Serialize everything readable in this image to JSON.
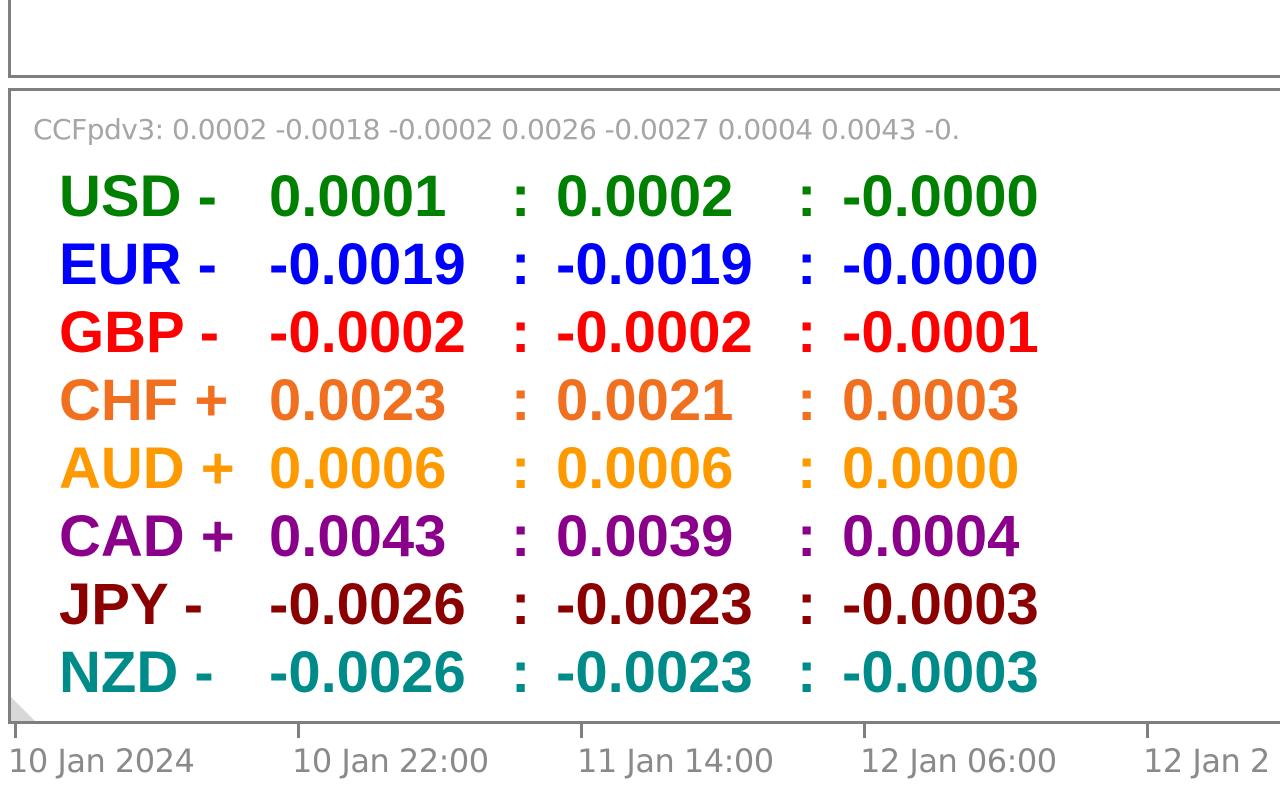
{
  "indicator": {
    "header": "CCFpdv3: 0.0002 -0.0018 -0.0002 0.0026 -0.0027 0.0004 0.0043 -0.",
    "rows": [
      {
        "symbol": "USD -",
        "v1": "0.0001",
        "sep1": ":",
        "v2": "0.0002",
        "sep2": ":",
        "v3": "-0.0000",
        "color": "#008000"
      },
      {
        "symbol": "EUR -",
        "v1": "-0.0019",
        "sep1": ":",
        "v2": "-0.0019",
        "sep2": ":",
        "v3": "-0.0000",
        "color": "#0000ff"
      },
      {
        "symbol": "GBP -",
        "v1": "-0.0002",
        "sep1": ":",
        "v2": "-0.0002",
        "sep2": ":",
        "v3": "-0.0001",
        "color": "#ff0000"
      },
      {
        "symbol": "CHF +",
        "v1": "0.0023",
        "sep1": ":",
        "v2": "0.0021",
        "sep2": ":",
        "v3": "0.0003",
        "color": "#f07020"
      },
      {
        "symbol": "AUD +",
        "v1": "0.0006",
        "sep1": ":",
        "v2": "0.0006",
        "sep2": ":",
        "v3": "0.0000",
        "color": "#ff9900"
      },
      {
        "symbol": "CAD +",
        "v1": "0.0043",
        "sep1": ":",
        "v2": "0.0039",
        "sep2": ":",
        "v3": "0.0004",
        "color": "#8b008b"
      },
      {
        "symbol": "JPY -",
        "v1": "-0.0026",
        "sep1": ":",
        "v2": "-0.0023",
        "sep2": ":",
        "v3": "-0.0003",
        "color": "#8b0000"
      },
      {
        "symbol": "NZD -",
        "v1": "-0.0026",
        "sep1": ":",
        "v2": "-0.0023",
        "sep2": ":",
        "v3": "-0.0003",
        "color": "#008b8b"
      }
    ]
  },
  "time_axis": {
    "labels": [
      "10 Jan 2024",
      "10 Jan 22:00",
      "11 Jan 14:00",
      "12 Jan 06:00",
      "12 Jan 2"
    ]
  }
}
